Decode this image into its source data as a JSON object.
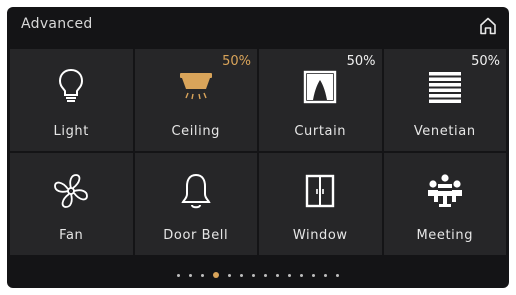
{
  "header": {
    "title": "Advanced"
  },
  "tiles": [
    {
      "label": "Light",
      "icon": "bulb-icon",
      "value": ""
    },
    {
      "label": "Ceiling",
      "icon": "ceiling-lamp-icon",
      "value": "50%"
    },
    {
      "label": "Curtain",
      "icon": "curtain-icon",
      "value": "50%"
    },
    {
      "label": "Venetian",
      "icon": "venetian-blind-icon",
      "value": "50%"
    },
    {
      "label": "Fan",
      "icon": "fan-icon",
      "value": ""
    },
    {
      "label": "Door Bell",
      "icon": "bell-icon",
      "value": ""
    },
    {
      "label": "Window",
      "icon": "window-icon",
      "value": ""
    },
    {
      "label": "Meeting",
      "icon": "meeting-icon",
      "value": ""
    }
  ],
  "pager": {
    "count": 14,
    "active": 3
  },
  "colors": {
    "accent": "#d9a45a",
    "panel": "#141416",
    "tile": "#262628",
    "text": "#e6e6e6"
  }
}
